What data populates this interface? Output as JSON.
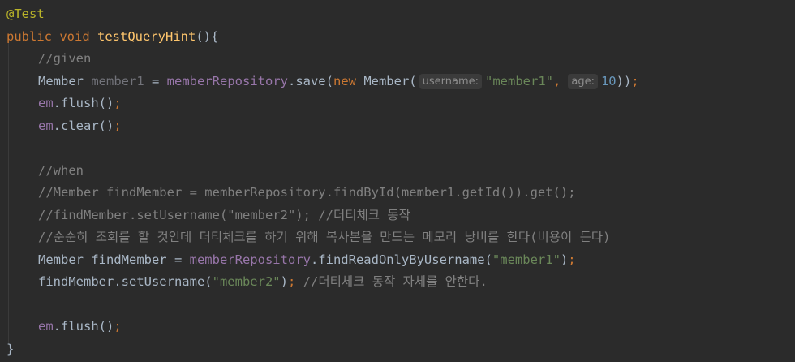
{
  "editor": {
    "lines": {
      "l1": {
        "annotation": "@Test"
      },
      "l2": {
        "kw_public": "public",
        "kw_void": "void",
        "method_name": "testQueryHint",
        "tail": "(){"
      },
      "l3": {
        "comment": "//given"
      },
      "l4": {
        "type": "Member",
        "var": "member1",
        "op": " = ",
        "field": "memberRepository",
        "call": ".save(",
        "kw_new": "new",
        "ctor": " Member(",
        "hint1": "username:",
        "arg1": "\"member1\"",
        "comma": ",",
        "hint2": "age:",
        "arg2": "10",
        "close": "))",
        "semi": ";"
      },
      "l5": {
        "field": "em",
        "call": ".flush()",
        "semi": ";"
      },
      "l6": {
        "field": "em",
        "call": ".clear()",
        "semi": ";"
      },
      "l8": {
        "comment": "//when"
      },
      "l9": {
        "comment": "//Member findMember = memberRepository.findById(member1.getId()).get();"
      },
      "l10": {
        "comment": "//findMember.setUsername(\"member2\"); //더티체크 동작"
      },
      "l11": {
        "comment": "//순순히 조회를 할 것인데 더티체크를 하기 위해 복사본을 만드는 메모리 낭비를 한다(비용이 든다)"
      },
      "l12": {
        "pre": "Member findMember = ",
        "field": "memberRepository",
        "call": ".findReadOnlyByUsername(",
        "arg": "\"member1\"",
        "close": ")",
        "semi": ";"
      },
      "l13": {
        "pre": "findMember.setUsername(",
        "arg": "\"member2\"",
        "close": ")",
        "semi": ";",
        "comment": " //더티체크 동작 자체를 안한다."
      },
      "l15": {
        "field": "em",
        "call": ".flush()",
        "semi": ";"
      },
      "l16": {
        "brace": "}"
      }
    }
  }
}
